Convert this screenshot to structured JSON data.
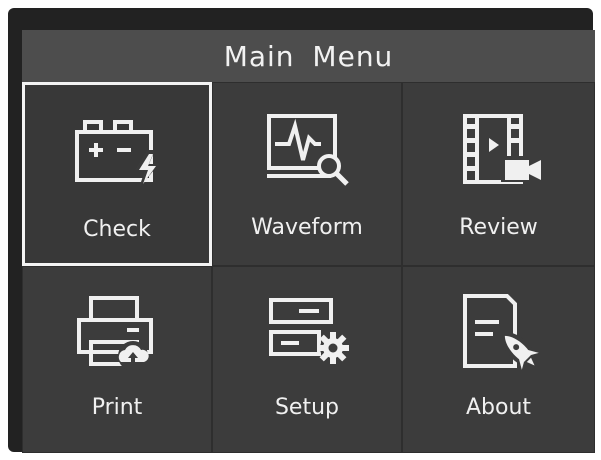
{
  "title": "Main Menu",
  "menu_items": [
    {
      "label": "Check",
      "icon": "battery-icon",
      "selected": true
    },
    {
      "label": "Waveform",
      "icon": "waveform-icon",
      "selected": false
    },
    {
      "label": "Review",
      "icon": "film-video-icon",
      "selected": false
    },
    {
      "label": "Print",
      "icon": "printer-icon",
      "selected": false
    },
    {
      "label": "Setup",
      "icon": "settings-icon",
      "selected": false
    },
    {
      "label": "About",
      "icon": "document-rocket-icon",
      "selected": false
    }
  ],
  "colors": {
    "screen_bg": "#2f2f2f",
    "title_bg": "#4d4d4d",
    "tile_bg": "#3c3c3c",
    "foreground": "#f0f0f0",
    "selection_border": "#f4f4f4"
  }
}
